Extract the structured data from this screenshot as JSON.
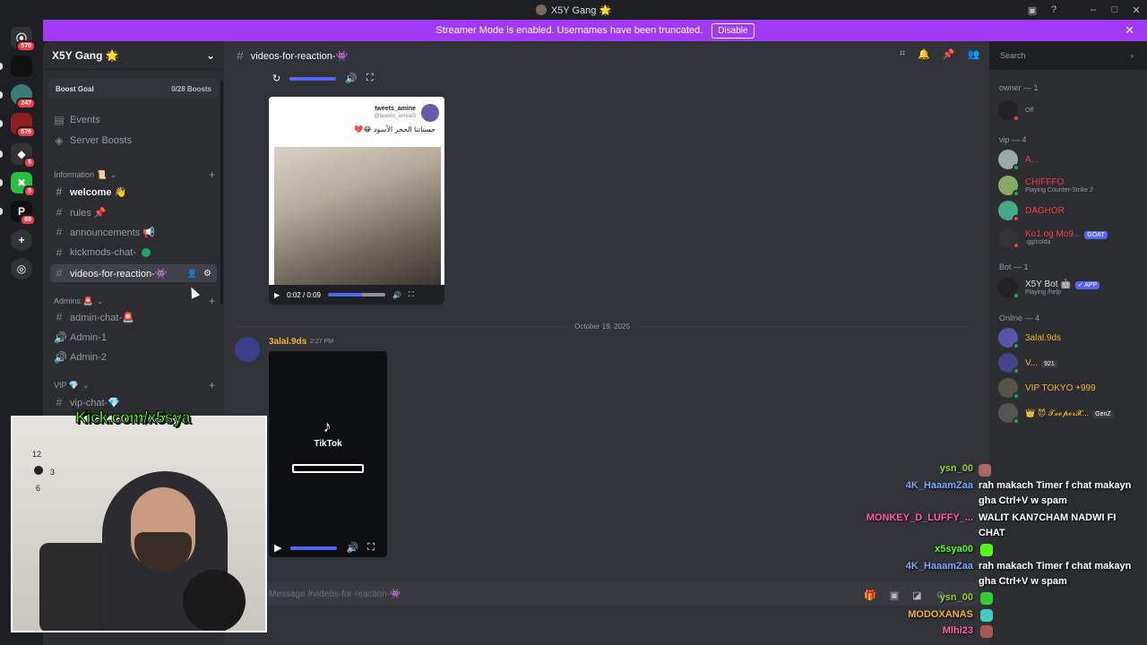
{
  "window": {
    "title": "X5Y Gang 🌟"
  },
  "banner": {
    "text": "Streamer Mode is enabled. Usernames have been truncated.",
    "button": "Disable"
  },
  "rail": {
    "servers": [
      {
        "icon": "discord-icon",
        "badge": "570"
      },
      {
        "icon": "server-dark",
        "badge": ""
      },
      {
        "icon": "server-avatar",
        "badge": "247"
      },
      {
        "icon": "server-red",
        "badge": "576"
      },
      {
        "icon": "server-white",
        "badge": "5"
      },
      {
        "icon": "server-green",
        "badge": "5"
      },
      {
        "icon": "server-p",
        "badge": "69"
      }
    ]
  },
  "sidebar": {
    "server_name": "X5Y Gang 🌟",
    "boost_goal": "Boost Goal",
    "boost_count": "0/28 Boosts",
    "top_items": [
      "Events",
      "Server Boosts"
    ],
    "cat_information": "Information 📜",
    "channels_info": [
      "welcome 👋",
      "rules 📌",
      "announcements 📢",
      "kickmods-chat-",
      "videos-for-reaction-👾"
    ],
    "cat_admins": "Admins 🚨",
    "channels_admin": [
      "admin-chat-🚨",
      "Admin-1",
      "Admin-2"
    ],
    "cat_vip": "VIP 💎",
    "channels_vip": [
      "vip-chat-💎"
    ]
  },
  "chat": {
    "channel": "videos-for-reaction-👾",
    "search_placeholder": "Search",
    "video1_time": "0:02 / 0:09",
    "tweet_name": "tweets_amine",
    "tweet_handle": "@tweets_amine3",
    "tweet_text": "حسناتنا الحجر الأسود 😂💔",
    "date_divider": "October 19, 2025",
    "author": "3alal.9ds",
    "time": "2:27 PM",
    "tiktok": "TikTok",
    "compose_placeholder": "Message #videos-for-reaction-👾"
  },
  "members": {
    "owner_header": "owner — 1",
    "owner": [
      {
        "name": "",
        "sub": "Off"
      }
    ],
    "vip_header": "vip — 4",
    "vip": [
      {
        "name": "A...",
        "sub": ""
      },
      {
        "name": "CHIFFFO",
        "sub": "Playing Counter-Strike 2"
      },
      {
        "name": "DAGHOR",
        "sub": ""
      },
      {
        "name": "Ko1.og Mo9...",
        "sub": ".gg/colda",
        "tag": "GOAT"
      }
    ],
    "bot_header": "Bot — 1",
    "bot": [
      {
        "name": "X5Y Bot 🤖",
        "sub": "Playing /help",
        "tag": "✓ APP"
      }
    ],
    "online_header": "Online — 4",
    "online": [
      {
        "name": "3alal.9ds"
      },
      {
        "name": "V...",
        "tag": "921"
      },
      {
        "name": "VIP TOKYO +999"
      },
      {
        "name": "👑 😈 𝓣𝔁𝓸𝓹𝓮𝓻𝓧...",
        "tag": "GenZ"
      }
    ]
  },
  "stream_chat": [
    {
      "name": "ysn_00",
      "msg": "",
      "color": "#9bd33a"
    },
    {
      "name": "4K_HaaamZaa",
      "msg": "rah makach Timer f chat makayn gha Ctrl+V w spam",
      "color": "#7ba7ff"
    },
    {
      "name": "MONKEY_D_LUFFY_...",
      "msg": "WALIT KAN7CHAM NADWI FI CHAT",
      "color": "#ff5fa0"
    },
    {
      "name": "x5sya00",
      "msg": "",
      "color": "#53fc18"
    },
    {
      "name": "4K_HaaamZaa",
      "msg": "rah makach Timer f chat makayn gha Ctrl+V w spam",
      "color": "#7ba7ff"
    },
    {
      "name": "ysn_00",
      "msg": "",
      "color": "#9bd33a"
    },
    {
      "name": "MODOXANAS",
      "msg": "",
      "color": "#f0b232"
    },
    {
      "name": "Mlhi23",
      "msg": "",
      "color": "#ff5fa0"
    }
  ],
  "overlay": {
    "kick_url": "Kick.com/x5sya"
  }
}
